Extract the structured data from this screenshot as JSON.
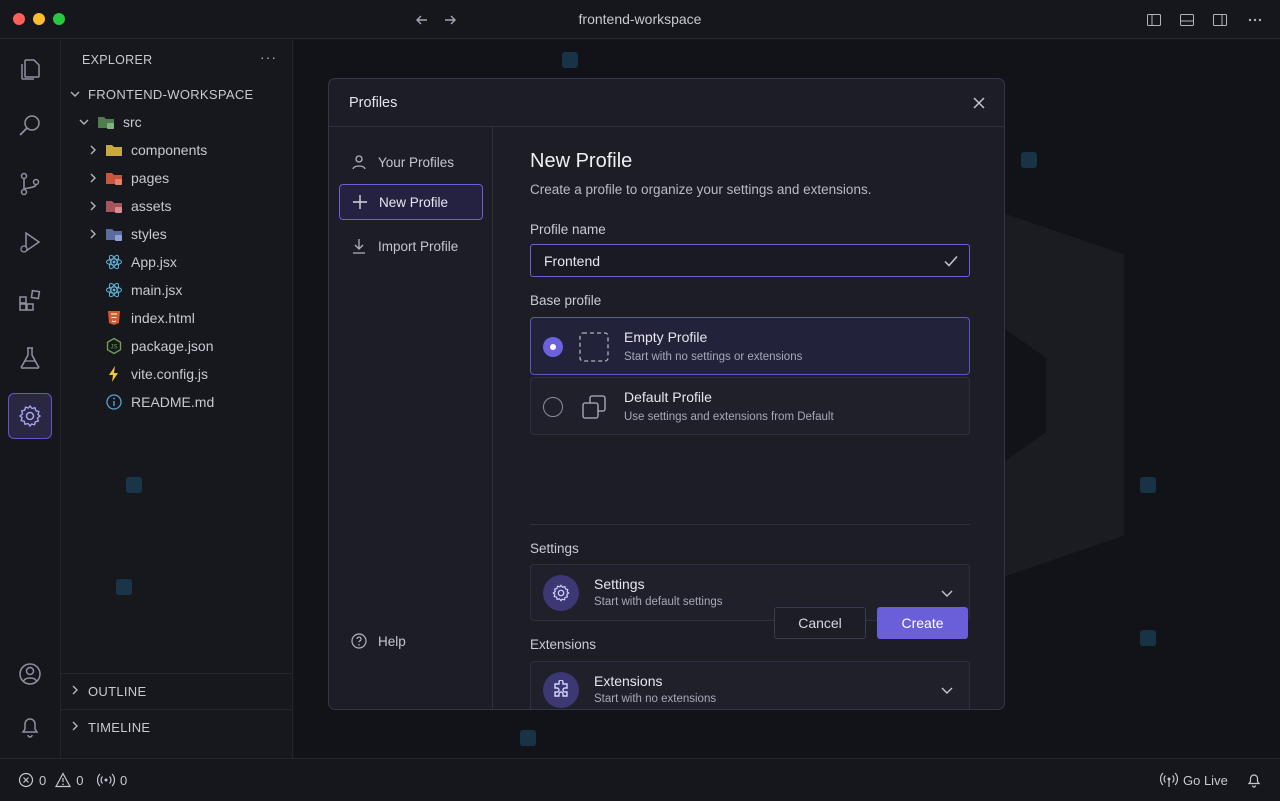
{
  "window": {
    "title": "frontend-workspace"
  },
  "sidebar": {
    "title": "EXPLORER",
    "more": "···",
    "root": "FRONTEND-WORKSPACE",
    "tree": [
      {
        "label": "src"
      },
      {
        "label": "components"
      },
      {
        "label": "pages"
      },
      {
        "label": "assets"
      },
      {
        "label": "styles"
      },
      {
        "label": "App.jsx"
      },
      {
        "label": "main.jsx"
      },
      {
        "label": "index.html"
      },
      {
        "label": "package.json"
      },
      {
        "label": "vite.config.js"
      },
      {
        "label": "README.md"
      }
    ],
    "outline": "OUTLINE",
    "timeline": "TIMELINE"
  },
  "statusbar": {
    "errors": "0",
    "warnings": "0",
    "ports": "0",
    "go_live": "Go Live"
  },
  "modal": {
    "title": "Profiles",
    "nav": {
      "your_profiles": "Your Profiles",
      "new_profile": "New Profile",
      "import_profile": "Import Profile",
      "help": "Help"
    },
    "heading": "New Profile",
    "subtitle": "Create a profile to organize your settings and extensions.",
    "profile_name_label": "Profile name",
    "profile_name_value": "Frontend",
    "base_profile_label": "Base profile",
    "base_options": [
      {
        "title": "Empty Profile",
        "desc": "Start with no settings or extensions",
        "selected": true
      },
      {
        "title": "Default Profile",
        "desc": "Use settings and extensions from Default",
        "selected": false
      }
    ],
    "settings_label": "Settings",
    "settings_card": {
      "title": "Settings",
      "desc": "Start with default settings"
    },
    "extensions_label": "Extensions",
    "extensions_card": {
      "title": "Extensions",
      "desc": "Start with no extensions"
    },
    "cancel": "Cancel",
    "create": "Create"
  },
  "colors": {
    "accent": "#6a5ed9",
    "background": "#16171d",
    "modal": "#1c1d25"
  },
  "icons": [
    "files-icon",
    "search-icon",
    "source-control-icon",
    "run-debug-icon",
    "extensions-icon",
    "testing-icon",
    "settings-gear-icon",
    "account-icon",
    "bell-icon"
  ]
}
